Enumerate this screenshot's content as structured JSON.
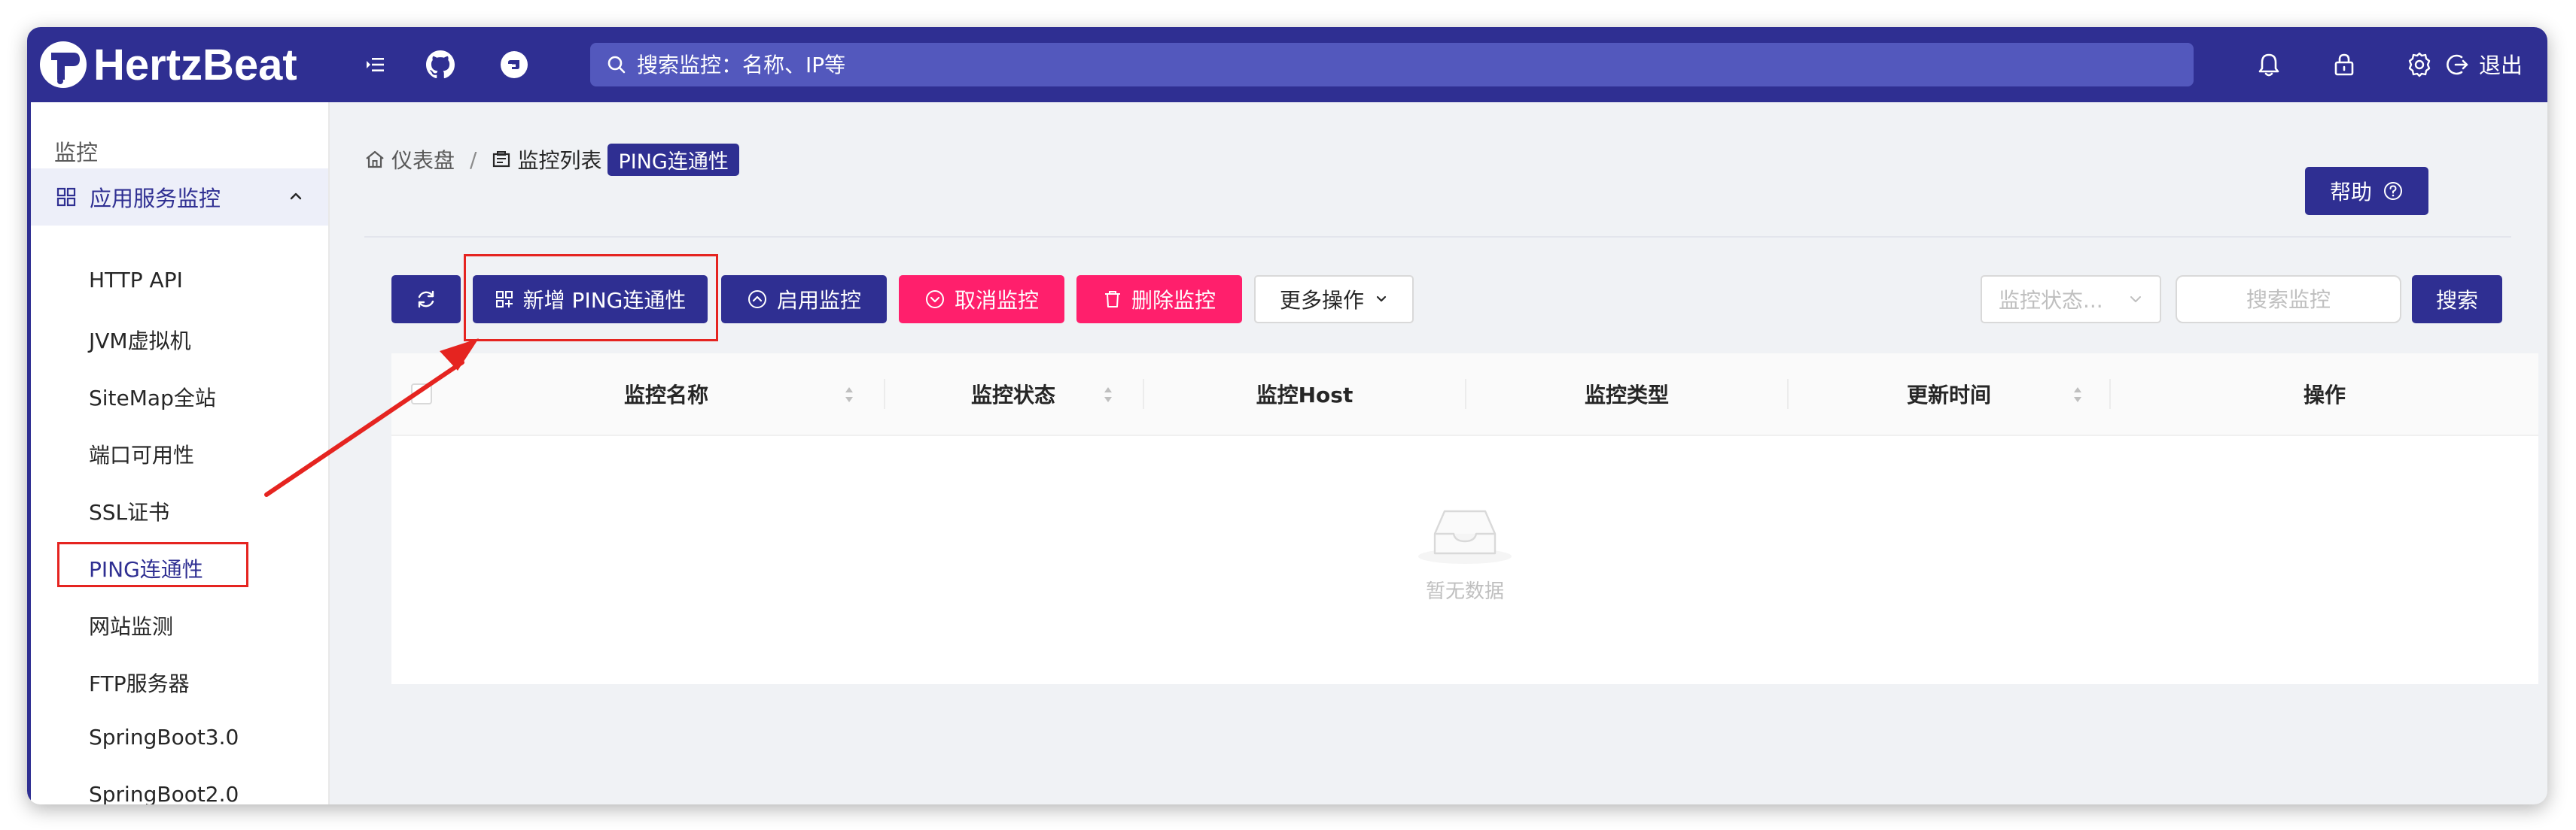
{
  "header": {
    "logo_text": "HertzBeat",
    "search_placeholder": "搜索监控：名称、IP等",
    "logout_label": "退出"
  },
  "sidebar": {
    "section_title": "监控",
    "group_label": "应用服务监控",
    "items": [
      "HTTP API",
      "JVM虚拟机",
      "SiteMap全站",
      "端口可用性",
      "SSL证书",
      "PING连通性",
      "网站监测",
      "FTP服务器",
      "SpringBoot3.0",
      "SpringBoot2.0"
    ],
    "active_item": "PING连通性"
  },
  "breadcrumb": {
    "home": "仪表盘",
    "separator": "/",
    "current": "监控列表",
    "tag": "PING连通性"
  },
  "help_label": "帮助",
  "toolbar": {
    "add_label": "新增 PING连通性",
    "enable_label": "启用监控",
    "cancel_label": "取消监控",
    "delete_label": "删除监控",
    "more_label": "更多操作",
    "status_placeholder": "监控状态...",
    "search_placeholder": "搜索监控",
    "search_button": "搜索"
  },
  "table": {
    "columns": [
      "监控名称",
      "监控状态",
      "监控Host",
      "监控类型",
      "更新时间",
      "操作"
    ],
    "empty_text": "暂无数据"
  },
  "colors": {
    "primary": "#2f2f92",
    "danger": "#ff1f6c",
    "annotation": "#e52420"
  }
}
